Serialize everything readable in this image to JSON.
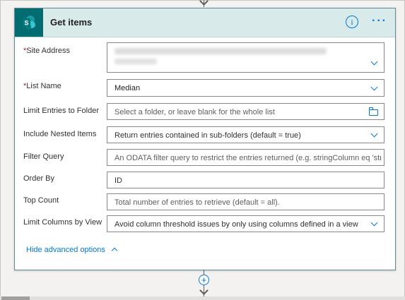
{
  "card": {
    "title": "Get items",
    "info_label": "i",
    "more_label": "···"
  },
  "fields": {
    "site_address": {
      "label": "Site Address",
      "required": "*"
    },
    "list_name": {
      "label": "List Name",
      "required": "*",
      "value": "Median"
    },
    "limit_entries": {
      "label": "Limit Entries to Folder",
      "placeholder": "Select a folder, or leave blank for the whole list"
    },
    "include_nested": {
      "label": "Include Nested Items",
      "value": "Return entries contained in sub-folders (default = true)"
    },
    "filter_query": {
      "label": "Filter Query",
      "placeholder": "An ODATA filter query to restrict the entries returned (e.g. stringColumn eq 'stri"
    },
    "order_by": {
      "label": "Order By",
      "value": "ID"
    },
    "top_count": {
      "label": "Top Count",
      "placeholder": "Total number of entries to retrieve (default = all)."
    },
    "limit_columns": {
      "label": "Limit Columns by View",
      "value": "Avoid column threshold issues by only using columns defined in a view"
    }
  },
  "hide_advanced": "Hide advanced options",
  "add_step_label": "+",
  "colors": {
    "header_bg": "#d9eaeb",
    "sharepoint": "#036c70",
    "accent": "#0078d4",
    "required": "#a4262c"
  },
  "icons": [
    "sharepoint-icon",
    "info-icon",
    "more-icon",
    "chevron-down-icon",
    "folder-icon",
    "chevron-up-icon",
    "add-step-icon",
    "arrow-down-icon"
  ]
}
